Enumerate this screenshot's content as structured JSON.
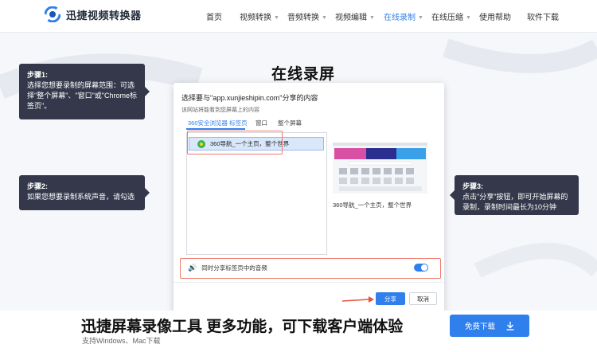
{
  "app": {
    "brand": "迅捷视频转换器"
  },
  "nav": {
    "items": [
      {
        "label": "首页",
        "dropdown": false,
        "active": false
      },
      {
        "label": "视频转换",
        "dropdown": true,
        "active": false
      },
      {
        "label": "音频转换",
        "dropdown": true,
        "active": false
      },
      {
        "label": "视频编辑",
        "dropdown": true,
        "active": false
      },
      {
        "label": "在线录制",
        "dropdown": true,
        "active": true
      },
      {
        "label": "在线压缩",
        "dropdown": true,
        "active": false
      },
      {
        "label": "使用帮助",
        "dropdown": false,
        "active": false
      },
      {
        "label": "软件下载",
        "dropdown": false,
        "active": false
      }
    ]
  },
  "page": {
    "title": "在线录屏"
  },
  "steps": [
    {
      "title": "步骤1:",
      "text": "选择您想要录制的屏幕范围：可选择\"整个屏幕\"、\"窗口\"或\"Chrome标签页\"。"
    },
    {
      "title": "步骤2:",
      "text": "如果您想要录制系统声音，请勾选"
    },
    {
      "title": "步骤3:",
      "text": "点击\"分享\"按钮，即可开始屏幕的录制，录制时间最长为10分钟"
    }
  ],
  "dialog": {
    "title": "选择要与\"app.xunjieshipin.com\"分享的内容",
    "subtitle": "该网站将能看到您屏幕上的内容",
    "tabs": [
      "360安全浏览器 标签页",
      "窗口",
      "整个屏幕"
    ],
    "list_item": "360导航_一个主页，整个世界",
    "preview_caption": "360导航_一个主页，整个世界",
    "audio_label": "同时分享标签页中的音频",
    "audio_enabled": true,
    "share_button": "分享",
    "cancel_button": "取消"
  },
  "cta": {
    "title": "迅捷屏幕录像工具 更多功能，可下载客户端体验",
    "subtitle": "支持Windows、Mac下载",
    "download_button": "免费下载"
  },
  "colors": {
    "accent": "#2f80ed",
    "step_bg": "#34384a",
    "highlight": "#f07a6c"
  }
}
